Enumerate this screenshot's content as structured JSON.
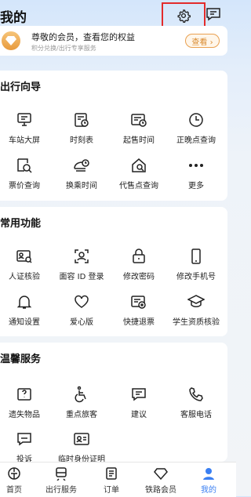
{
  "header": {
    "title": "我的"
  },
  "member": {
    "title": "尊敬的会员，查看您的权益",
    "subtitle": "积分兑换/出行专享服务",
    "button": "查看 ›"
  },
  "travel": {
    "title": "出行向导",
    "items": [
      {
        "label": "车站大屏",
        "icon": "monitor-icon"
      },
      {
        "label": "时刻表",
        "icon": "timetable-icon"
      },
      {
        "label": "起售时间",
        "icon": "sale-time-icon"
      },
      {
        "label": "正晚点查询",
        "icon": "clock-icon"
      },
      {
        "label": "票价查询",
        "icon": "price-query-icon"
      },
      {
        "label": "换乘时间",
        "icon": "transfer-icon"
      },
      {
        "label": "代售点查询",
        "icon": "agent-point-icon"
      },
      {
        "label": "更多",
        "icon": "more-icon"
      }
    ]
  },
  "common": {
    "title": "常用功能",
    "items": [
      {
        "label": "人证核验",
        "icon": "id-verify-icon"
      },
      {
        "label": "面容 ID 登录",
        "icon": "face-id-icon"
      },
      {
        "label": "修改密码",
        "icon": "lock-icon"
      },
      {
        "label": "修改手机号",
        "icon": "phone-icon"
      },
      {
        "label": "通知设置",
        "icon": "bell-icon"
      },
      {
        "label": "爱心版",
        "icon": "heart-icon"
      },
      {
        "label": "快捷退票",
        "icon": "refund-icon"
      },
      {
        "label": "学生资质核验",
        "icon": "graduation-cap-icon"
      }
    ]
  },
  "warm": {
    "title": "温馨服务",
    "items": [
      {
        "label": "遗失物品",
        "icon": "lost-item-icon"
      },
      {
        "label": "重点旅客",
        "icon": "wheelchair-icon"
      },
      {
        "label": "建议",
        "icon": "suggestion-icon"
      },
      {
        "label": "客服电话",
        "icon": "phone-call-icon"
      },
      {
        "label": "投诉",
        "icon": "complaint-icon"
      },
      {
        "label": "临时身份证明",
        "icon": "temp-id-icon"
      }
    ]
  },
  "tabbar": {
    "items": [
      {
        "label": "首页",
        "icon": "home-icon"
      },
      {
        "label": "出行服务",
        "icon": "train-icon"
      },
      {
        "label": "订单",
        "icon": "order-icon"
      },
      {
        "label": "铁路会员",
        "icon": "diamond-icon"
      },
      {
        "label": "我的",
        "icon": "user-icon"
      }
    ],
    "active_color": "#3a7ff2"
  }
}
